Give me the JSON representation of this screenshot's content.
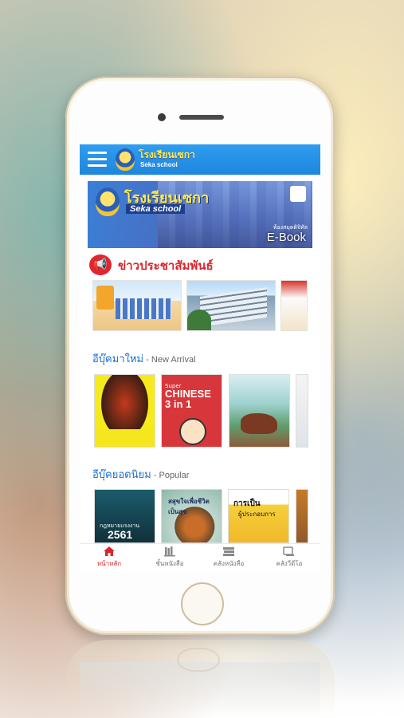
{
  "header": {
    "brand_thai": "โรงเรียนเซกา",
    "brand_en": "Seka school"
  },
  "banner": {
    "title_thai": "โรงเรียนเซกา",
    "title_en": "Seka school",
    "library_label": "ห้องสมุดดิจิทัล",
    "ebook_label": "E-Book"
  },
  "news": {
    "title": "ข่าวประชาสัมพันธ์"
  },
  "new_arrival": {
    "title_thai": "อีบุ๊คมาใหม่",
    "separator": " - ",
    "title_en": "New Arrival",
    "books": [
      {
        "cover_line1": "Super",
        "cover_line2": "CHINESE",
        "cover_line3": "3 in 1"
      }
    ]
  },
  "popular": {
    "title_thai": "อีบุ๊คยอดนิยม",
    "separator": " - ",
    "title_en": "Popular",
    "books": [
      {
        "cover_title": "กฎหมายแรงงาน",
        "cover_number": "2561"
      },
      {
        "cover_title": "สสุขใจเพื่อชีวิตเป็นสุข"
      },
      {
        "cover_title": "การเป็น",
        "cover_subtitle": "ผู้ประกอบการ"
      }
    ]
  },
  "tabbar": {
    "items": [
      {
        "label": "หน้าหลัก",
        "icon": "home-icon",
        "active": true
      },
      {
        "label": "ชั้นหนังสือ",
        "icon": "bookshelf-icon",
        "active": false
      },
      {
        "label": "คลังหนังสือ",
        "icon": "book-stack-icon",
        "active": false
      },
      {
        "label": "คลังวีดีโอ",
        "icon": "video-icon",
        "active": false
      }
    ]
  },
  "colors": {
    "topbar": "#1d86de",
    "news_accent": "#d9262e",
    "section_title": "#1a6fd0"
  }
}
